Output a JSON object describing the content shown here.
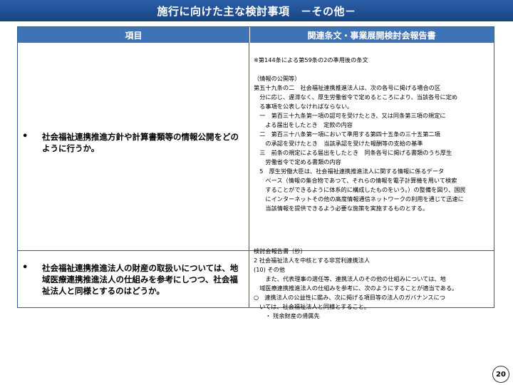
{
  "title": "施行に向けた主な検討事項　－その他－",
  "table": {
    "headers": [
      "項目",
      "関連条文・事業展開検討会報告書"
    ],
    "rows": [
      {
        "bullet": "•",
        "item": "社会福祉連携推進方針や計算書類等の情報公開をどのように行うか。",
        "reference_lines": [
          "※第144条による第59条の2の準用後の条文",
          "",
          "（情報の公開等）",
          "第五十九条の二　社会福祉連携推進法人は、次の各号に掲げる場合の区",
          "　分に応じ、遅滞なく、厚生労働省令で定めるところにより、当該各号に定め",
          "　る事項を公表しなければならない。",
          "　一　第百三十九条第一項の認可を受けたとき、又は同条第三項の規定に",
          "　　よる届出をしたとき　定款の内容",
          "　二　第百三十八条第一項において準用する第四十五条の三十五第二項",
          "　　の承認を受けたとき　当該承認を受けた報酬等の支給の基準",
          "　三　前条の規定による届出をしたとき　同条各号に掲げる書類のうち厚生",
          "　　労働省令で定める書類の内容",
          "　5　厚生労働大臣は、社会福祉連携推進法人に関する情報に係るデータ",
          "　　ベース（情報の集合物であつて、それらの情報を電子計算機を用いて検索",
          "　　することができるように体系的に構成したものをいう。）の整備を図り、国民",
          "　　にインターネットその他の高度情報通信ネットワークの利用を通じて迅速に",
          "　　当該情報を提供できるよう必要な施策を実施するものとする。"
        ]
      },
      {
        "bullet": "•",
        "item": "社会福祉連携推進法人の財産の取扱いについては、地域医療連携推進法人の仕組みを参考にしつつ、社会福祉法人と同様とするのはどうか。",
        "reference_lines": [
          "検討会報告書（抄）",
          "2  社会福祉法人を中核とする非営利連携法人",
          "(10) その他",
          "　　また、代表理事の選任等、連携法人のその他の仕組みについては、地",
          "　域医療連携推進法人の仕組みを参考に、次のようにすることが適当である。",
          "○　連携法人の公益性に鑑み、次に掲げる項目等の法人のガバナンスにつ",
          "　いては、社会福祉法人と同様とすること。",
          "　　・ 残余財産の帰属先"
        ]
      }
    ]
  },
  "page_number": "20"
}
